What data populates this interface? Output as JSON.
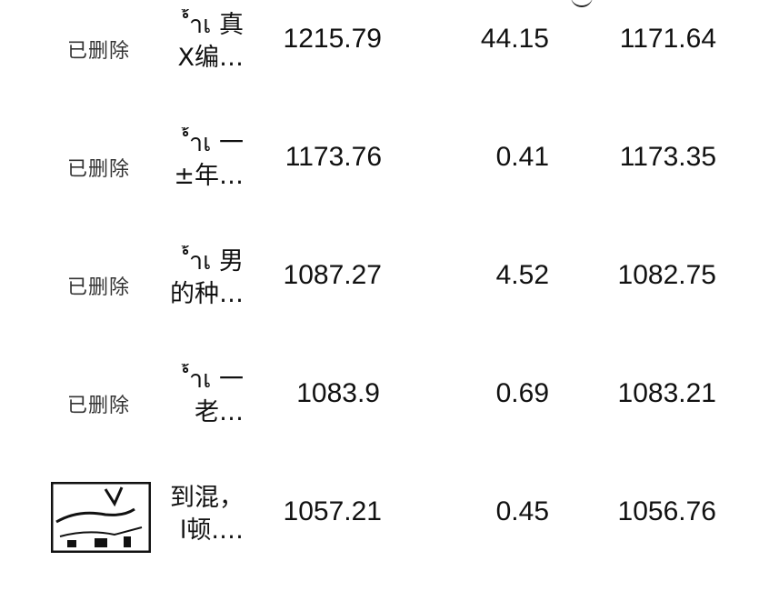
{
  "rows": [
    {
      "status": "已删除",
      "title_line1": "้ำเ 真",
      "title_line2": "X编…",
      "total": "1215.79",
      "deducted": "44.15",
      "net": "1171.64"
    },
    {
      "status": "已删除",
      "title_line1": "้ำเ 一",
      "title_line2": "±年…",
      "total": "1173.76",
      "deducted": "0.41",
      "net": "1173.35"
    },
    {
      "status": "已删除",
      "title_line1": "้ำเ 男",
      "title_line2": "的种…",
      "total": "1087.27",
      "deducted": "4.52",
      "net": "1082.75"
    },
    {
      "status": "已删除",
      "title_line1": "้ำเ 一",
      "title_line2": " 老…",
      "total": "1083.9",
      "deducted": "0.69",
      "net": "1083.21"
    },
    {
      "status": "",
      "title_line1": "到混，",
      "title_line2": "l顿.…",
      "total": "1057.21",
      "deducted": "0.45",
      "net": "1056.76",
      "thumbnail": "video-thumbnail-icon"
    }
  ]
}
